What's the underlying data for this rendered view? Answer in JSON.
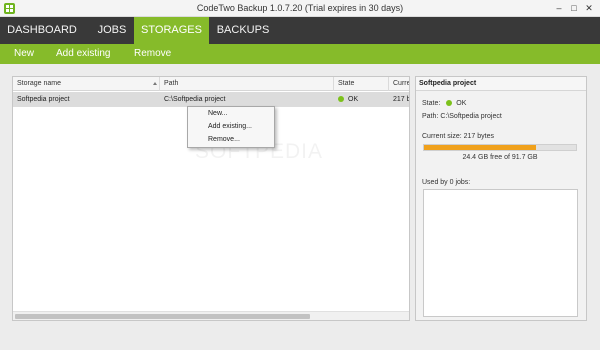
{
  "window": {
    "title": "CodeTwo Backup 1.0.7.20 (Trial expires in 30 days)",
    "minimize": "–",
    "maximize": "□",
    "close": "✕"
  },
  "nav": {
    "tabs": [
      {
        "label": "DASHBOARD",
        "active": false
      },
      {
        "label": "JOBS",
        "active": false
      },
      {
        "label": "STORAGES",
        "active": true
      },
      {
        "label": "BACKUPS",
        "active": false
      }
    ]
  },
  "actions": {
    "new_label": "New",
    "add_existing_label": "Add existing",
    "remove_label": "Remove"
  },
  "grid": {
    "columns": [
      "Storage name",
      "Path",
      "State",
      "Curre"
    ],
    "rows": [
      {
        "name": "Softpedia project",
        "path": "C:\\Softpedia project",
        "state": "OK",
        "current": "217 b"
      }
    ]
  },
  "context_menu": {
    "items": [
      "New...",
      "Add existing...",
      "Remove..."
    ]
  },
  "details": {
    "title": "Softpedia project",
    "state_label": "State:",
    "state_value": "OK",
    "path_label": "Path:",
    "path_value": "C:\\Softpedia project",
    "current_size": "Current size: 217 bytes",
    "free_space": "24.4 GB free of 91.7 GB",
    "used_fraction": 0.734,
    "used_by": "Used by 0 jobs:"
  },
  "watermark": "SOFTPEDIA",
  "colors": {
    "accent_green": "#86bb2a",
    "nav_dark": "#393939",
    "status_ok": "#7cc11b",
    "usage_bar": "#f0a11c"
  }
}
